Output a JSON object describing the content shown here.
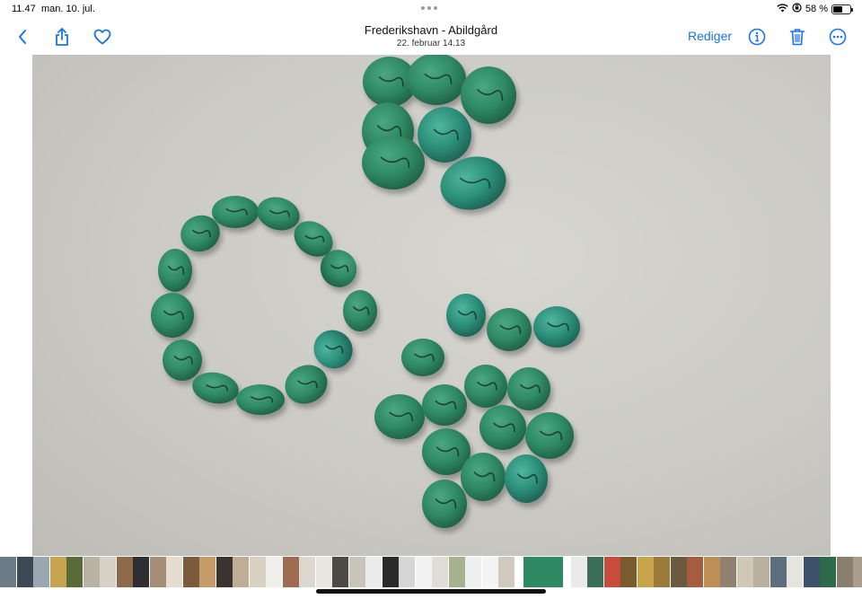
{
  "status_bar": {
    "time": "11.47",
    "date": "man. 10. jul.",
    "battery_text": "58 %",
    "battery_level": 0.58,
    "icons": [
      "wifi-icon",
      "orientation-lock-icon",
      "battery-icon"
    ]
  },
  "nav": {
    "title": "Frederikshavn - Abildgård",
    "subtitle": "22. februar  14.13",
    "edit_label": "Rediger",
    "icons": [
      "back-chevron-icon",
      "share-icon",
      "heart-icon",
      "info-icon",
      "trash-icon",
      "more-icon"
    ],
    "accent_color": "#1a73e8"
  },
  "photo": {
    "subject": "turquoise-beads",
    "background_color": "#cfcec8",
    "bead_color": "#2f8a63"
  },
  "filmstrip": {
    "thumbnail_colors": [
      "#6d7b86",
      "#3b4a55",
      "#9aa7b0",
      "#c7a44f",
      "#5a6b3a",
      "#b9b2a5",
      "#d8d2c6",
      "#8e6a4b",
      "#2e2f33",
      "#a48e78",
      "#e4dccf",
      "#7a5c3d",
      "#c69b6a",
      "#3a3430",
      "#bfae93",
      "#d9d2c2",
      "#f0eee9",
      "#9f6c52",
      "#dcd8d0",
      "#e8e6e1",
      "#4d4a46",
      "#c9c4b8",
      "#ececec",
      "#2a2a2a",
      "#d6d6d6",
      "#f2f2f2",
      "#e0ddd6",
      "#a7b28e",
      "#efefef",
      "#f4f4f4",
      "#cfc9be",
      "#2f8a63",
      "#eaeaea",
      "#3a6d5a",
      "#c94b3a",
      "#7a5a2f",
      "#c8a54a",
      "#9b7a3c",
      "#6b5a3e",
      "#a85c3f",
      "#bd8f56",
      "#8f8070",
      "#d1c7b5",
      "#b9b0a0",
      "#5d6f7c",
      "#e6e4df",
      "#3c4f6b",
      "#2c6a4a",
      "#8a7e6e",
      "#a99d8b",
      "#cfc2ab",
      "#b2a595",
      "#6b5146",
      "#d7d2c8",
      "#c23b3b",
      "#e9e7e3",
      "#dcd9d4",
      "#8e8a84",
      "#3f4a54",
      "#bdb7aa",
      "#a7a092",
      "#7a7464"
    ],
    "active_index": 31
  }
}
